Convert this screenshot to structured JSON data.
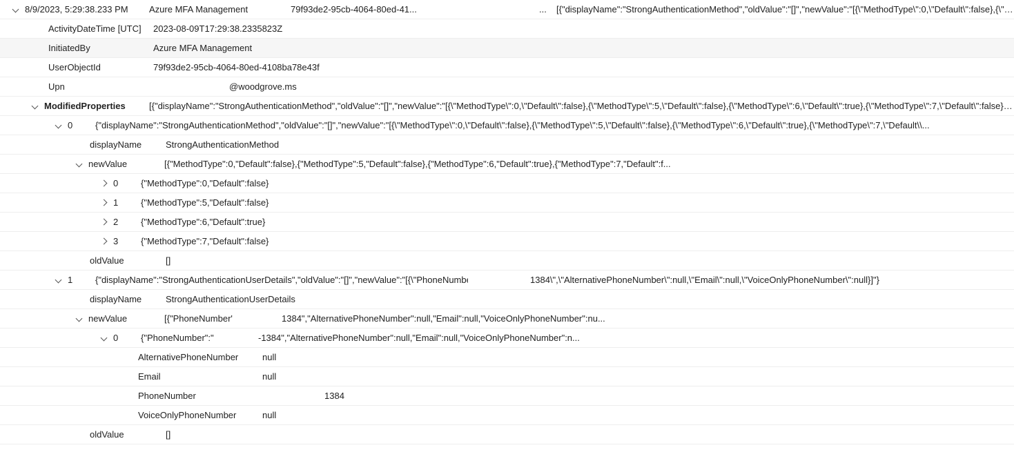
{
  "header": {
    "timestamp": "8/9/2023, 5:29:38.233 PM",
    "service": "Azure MFA Management",
    "objectId": "79f93de2-95cb-4064-80ed-41...",
    "ellipsis": "...",
    "json_preview": "[{\"displayName\":\"StrongAuthenticationMethod\",\"oldValue\":\"[]\",\"newValue\":\"[{\\\"MethodType\\\":0,\\\"Default\\\":false},{\\\"Meth"
  },
  "details": {
    "activity_label": "ActivityDateTime [UTC]",
    "activity_value": "2023-08-09T17:29:38.2335823Z",
    "initiatedby_label": "InitiatedBy",
    "initiatedby_value": "Azure MFA Management",
    "userobjectid_label": "UserObjectId",
    "userobjectid_value": "79f93de2-95cb-4064-80ed-4108ba78e43f",
    "upn_label": "Upn",
    "upn_value": "@woodgrove.ms"
  },
  "modprops": {
    "label": "ModifiedProperties",
    "summary": "[{\"displayName\":\"StrongAuthenticationMethod\",\"oldValue\":\"[]\",\"newValue\":\"[{\\\"MethodType\\\":0,\\\"Default\\\":false},{\\\"MethodType\\\":5,\\\"Default\\\":false},{\\\"MethodType\\\":6,\\\"Default\\\":true},{\\\"MethodType\\\":7,\\\"Default\\\":false}]\"},{\"c",
    "item0": {
      "index": "0",
      "summary": "{\"displayName\":\"StrongAuthenticationMethod\",\"oldValue\":\"[]\",\"newValue\":\"[{\\\"MethodType\\\":0,\\\"Default\\\":false},{\\\"MethodType\\\":5,\\\"Default\\\":false},{\\\"MethodType\\\":6,\\\"Default\\\":true},{\\\"MethodType\\\":7,\\\"Default\\\\...",
      "displayName_label": "displayName",
      "displayName_value": "StrongAuthenticationMethod",
      "newValue_label": "newValue",
      "newValue_summary": "[{\"MethodType\":0,\"Default\":false},{\"MethodType\":5,\"Default\":false},{\"MethodType\":6,\"Default\":true},{\"MethodType\":7,\"Default\":f...",
      "nv_items": [
        {
          "idx": "0",
          "val": "{\"MethodType\":0,\"Default\":false}"
        },
        {
          "idx": "1",
          "val": "{\"MethodType\":5,\"Default\":false}"
        },
        {
          "idx": "2",
          "val": "{\"MethodType\":6,\"Default\":true}"
        },
        {
          "idx": "3",
          "val": "{\"MethodType\":7,\"Default\":false}"
        }
      ],
      "oldValue_label": "oldValue",
      "oldValue_value": "[]"
    },
    "item1": {
      "index": "1",
      "summary_left": "{\"displayName\":\"StrongAuthenticationUserDetails\",\"oldValue\":\"[]\",\"newValue\":\"[{\\\"PhoneNumbe",
      "summary_right": "1384\\\",\\\"AlternativePhoneNumber\\\":null,\\\"Email\\\":null,\\\"VoiceOnlyPhoneNumber\\\":null}]\"}",
      "displayName_label": "displayName",
      "displayName_value": "StrongAuthenticationUserDetails",
      "newValue_label": "newValue",
      "newValue_summary_left": "[{\"PhoneNumber'",
      "newValue_summary_right": "1384\",\"AlternativePhoneNumber\":null,\"Email\":null,\"VoiceOnlyPhoneNumber\":nu...",
      "nv0": {
        "idx": "0",
        "summary_left": "{\"PhoneNumber\":\"",
        "summary_right": "-1384\",\"AlternativePhoneNumber\":null,\"Email\":null,\"VoiceOnlyPhoneNumber\":n...",
        "fields": {
          "altPhone_label": "AlternativePhoneNumber",
          "altPhone_value": "null",
          "email_label": "Email",
          "email_value": "null",
          "phone_label": "PhoneNumber",
          "phone_value": "1384",
          "voice_label": "VoiceOnlyPhoneNumber",
          "voice_value": "null"
        }
      },
      "oldValue_label": "oldValue",
      "oldValue_value": "[]"
    }
  }
}
